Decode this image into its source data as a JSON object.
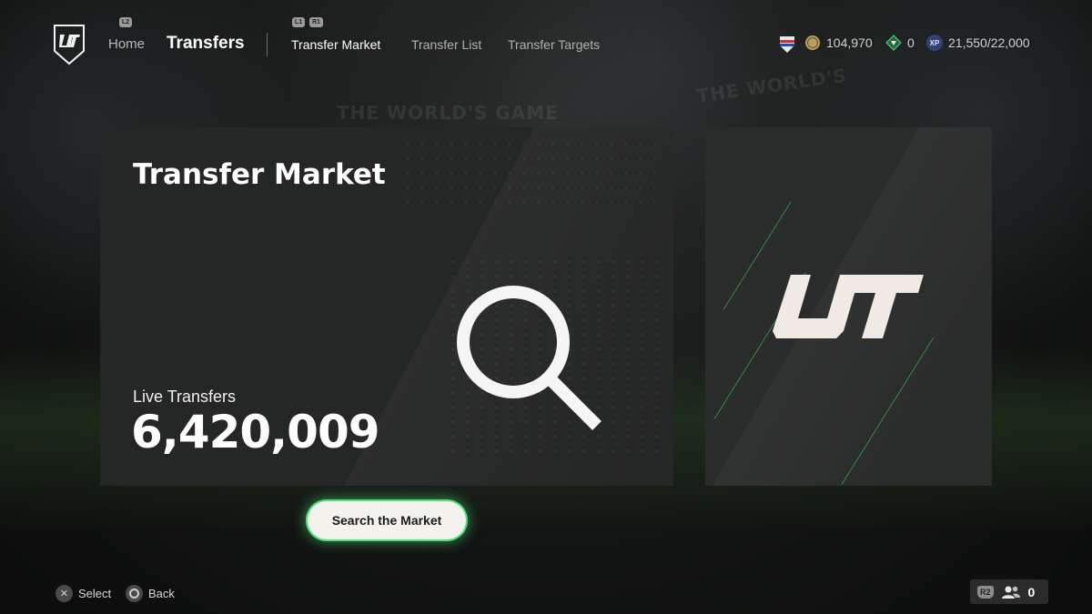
{
  "header": {
    "nav": {
      "home": "Home",
      "transfers": "Transfers",
      "l2_hint": "L2",
      "l1_hint": "L1",
      "r1_hint": "R1"
    },
    "subnav": {
      "market": "Transfer Market",
      "list": "Transfer List",
      "targets": "Transfer Targets"
    },
    "currencies": {
      "coins": "104,970",
      "points": "0",
      "xp": "21,550/22,000",
      "xp_badge": "XP"
    }
  },
  "background": {
    "slogan1": "THE WORLD'S GAME",
    "slogan2": "THE WORLD'S"
  },
  "main_panel": {
    "title": "Transfer Market",
    "live_label": "Live Transfers",
    "live_value": "6,420,009"
  },
  "action": {
    "search_label": "Search the Market"
  },
  "footer": {
    "select_label": "Select",
    "back_label": "Back",
    "r2_hint": "R2",
    "friends_count": "0"
  },
  "colors": {
    "accent": "#4ee27a",
    "panel": "#252626",
    "button": "#f4f2ed"
  }
}
